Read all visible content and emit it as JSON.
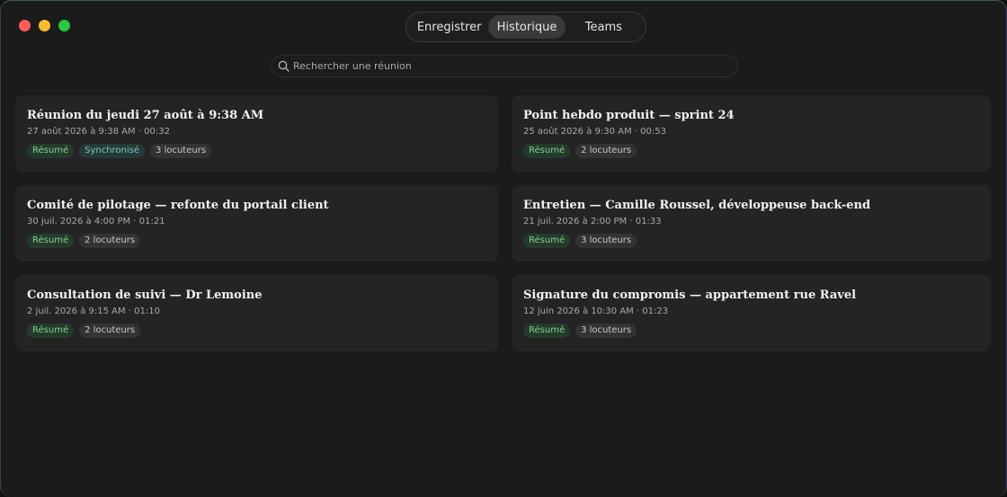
{
  "colors": {
    "accent_green": "#7ed38f",
    "accent_teal": "#7bc9bb",
    "window_bg": "#1b1b1b",
    "card_bg": "#242424"
  },
  "window_controls": [
    "close",
    "minimize",
    "zoom"
  ],
  "tabs": [
    {
      "label": "Enregistrer",
      "selected": false
    },
    {
      "label": "Historique",
      "selected": true
    },
    {
      "label": "Teams",
      "selected": false
    }
  ],
  "search": {
    "placeholder": "Rechercher une réunion",
    "value": "",
    "icon": "search-icon"
  },
  "meetings": [
    {
      "title": "Réunion du jeudi 27 août à 9:38 AM",
      "date": "27 août 2026 à 9:38 AM",
      "duration": "00:32",
      "tags": [
        "Résumé",
        "Synchronisé",
        "3 locuteurs"
      ]
    },
    {
      "title": "Point hebdo produit — sprint 24",
      "date": "25 août 2026 à 9:30 AM",
      "duration": "00:53",
      "tags": [
        "Résumé",
        "2 locuteurs"
      ]
    },
    {
      "title": "Comité de pilotage — refonte du portail client",
      "date": "30 juil. 2026 à 4:00 PM",
      "duration": "01:21",
      "tags": [
        "Résumé",
        "2 locuteurs"
      ]
    },
    {
      "title": "Entretien — Camille Roussel, développeuse back-end",
      "date": "21 juil. 2026 à 2:00 PM",
      "duration": "01:33",
      "tags": [
        "Résumé",
        "3 locuteurs"
      ]
    },
    {
      "title": "Consultation de suivi — Dr Lemoine",
      "date": "2 juil. 2026 à 9:15 AM",
      "duration": "01:10",
      "tags": [
        "Résumé",
        "2 locuteurs"
      ]
    },
    {
      "title": "Signature du compromis — appartement rue Ravel",
      "date": "12 juin 2026 à 10:30 AM",
      "duration": "01:23",
      "tags": [
        "Résumé",
        "3 locuteurs"
      ]
    }
  ]
}
